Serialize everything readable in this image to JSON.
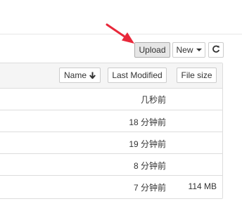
{
  "toolbar": {
    "upload_label": "Upload",
    "new_label": "New",
    "refresh_icon": "refresh-icon",
    "annotation_color": "#e8283a"
  },
  "list_header": {
    "name_label": "Name",
    "name_sort_icon": "arrow-down-icon",
    "last_modified_label": "Last Modified",
    "file_size_label": "File size"
  },
  "rows": [
    {
      "modified": "几秒前",
      "size": ""
    },
    {
      "modified": "18 分钟前",
      "size": ""
    },
    {
      "modified": "19 分钟前",
      "size": ""
    },
    {
      "modified": "8 分钟前",
      "size": ""
    },
    {
      "modified": "7 分钟前",
      "size": "114 MB"
    }
  ]
}
